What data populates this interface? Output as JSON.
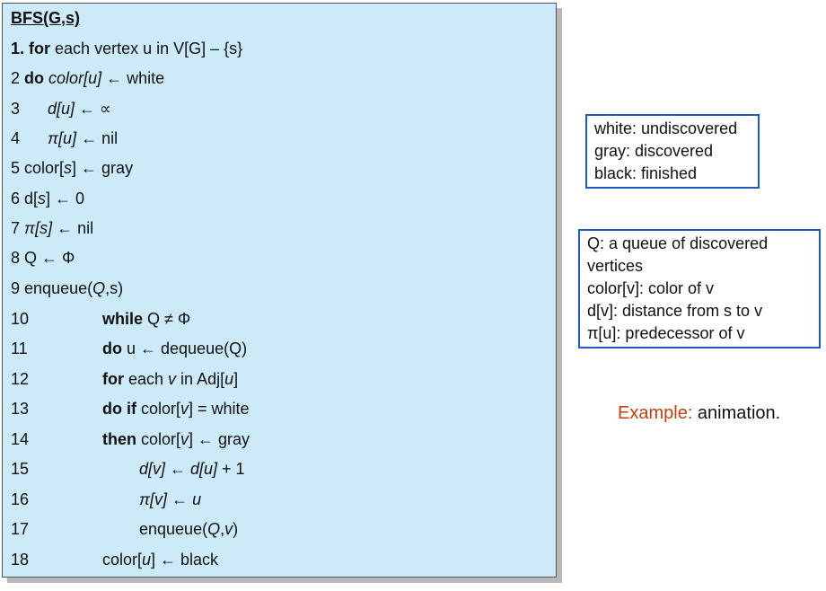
{
  "algorithm": {
    "title": "BFS(G,s)",
    "lines": [
      {
        "n": "1.",
        "a": "for",
        "b": " each vertex u in V[G] –  {s}"
      },
      {
        "n": "2",
        "a": "do",
        "c": "color",
        "d": "[u]",
        "e": " ← white"
      },
      {
        "n": "3",
        "a": "d[u]",
        "e": " ← ∝"
      },
      {
        "n": "4",
        "a": "π[u]",
        "e": " ← nil"
      },
      {
        "n": "5",
        "a": "color[",
        "c": "s",
        "e": "] ← gray"
      },
      {
        "n": "6",
        "a": "d[",
        "c": "s",
        "e": "] ← 0"
      },
      {
        "n": "7",
        "a": "π[s]",
        "e": " ← nil"
      },
      {
        "n": "8",
        "a": "Q ← Φ"
      },
      {
        "n": "9",
        "a": "enqueue(",
        "c": "Q",
        "e": ",s)"
      },
      {
        "n": "10",
        "a": "while",
        "b": " Q ≠ Φ"
      },
      {
        "n": "11",
        "a": "do",
        "b": " u ← dequeue(Q)"
      },
      {
        "n": "12",
        "a": "for",
        "b": " each ",
        "c": "v",
        "e": " in Adj[",
        "f": "u",
        "g": "]"
      },
      {
        "n": "13",
        "a": "do if",
        "b": " color[",
        "c": "v",
        "e": "] = white"
      },
      {
        "n": "14",
        "a": "then",
        "b": " color[",
        "c": "v",
        "e": "] ← gray"
      },
      {
        "n": "15",
        "a": "d[v] ← d[u]",
        "e": " + 1"
      },
      {
        "n": "16",
        "a": "π[v] ← u"
      },
      {
        "n": "17",
        "a": "enqueue(",
        "c": "Q",
        "e": ",",
        "f": "v",
        "g": ")"
      },
      {
        "n": "18",
        "a": "color[",
        "c": "u",
        "e": "] ← black"
      }
    ]
  },
  "legend_colors": [
    "white: undiscovered",
    "gray: discovered",
    "black: finished"
  ],
  "legend_terms": [
    "Q: a queue of discovered",
    "vertices",
    "color[v]: color of v",
    "d[v]: distance from s to v",
    "π[u]: predecessor of v"
  ],
  "example": {
    "prefix": "Example:",
    "link": " animation."
  },
  "colors": {
    "panel": "#cdeaf9",
    "legend_border": "#1f5bbf",
    "accent": "#c2410c"
  }
}
